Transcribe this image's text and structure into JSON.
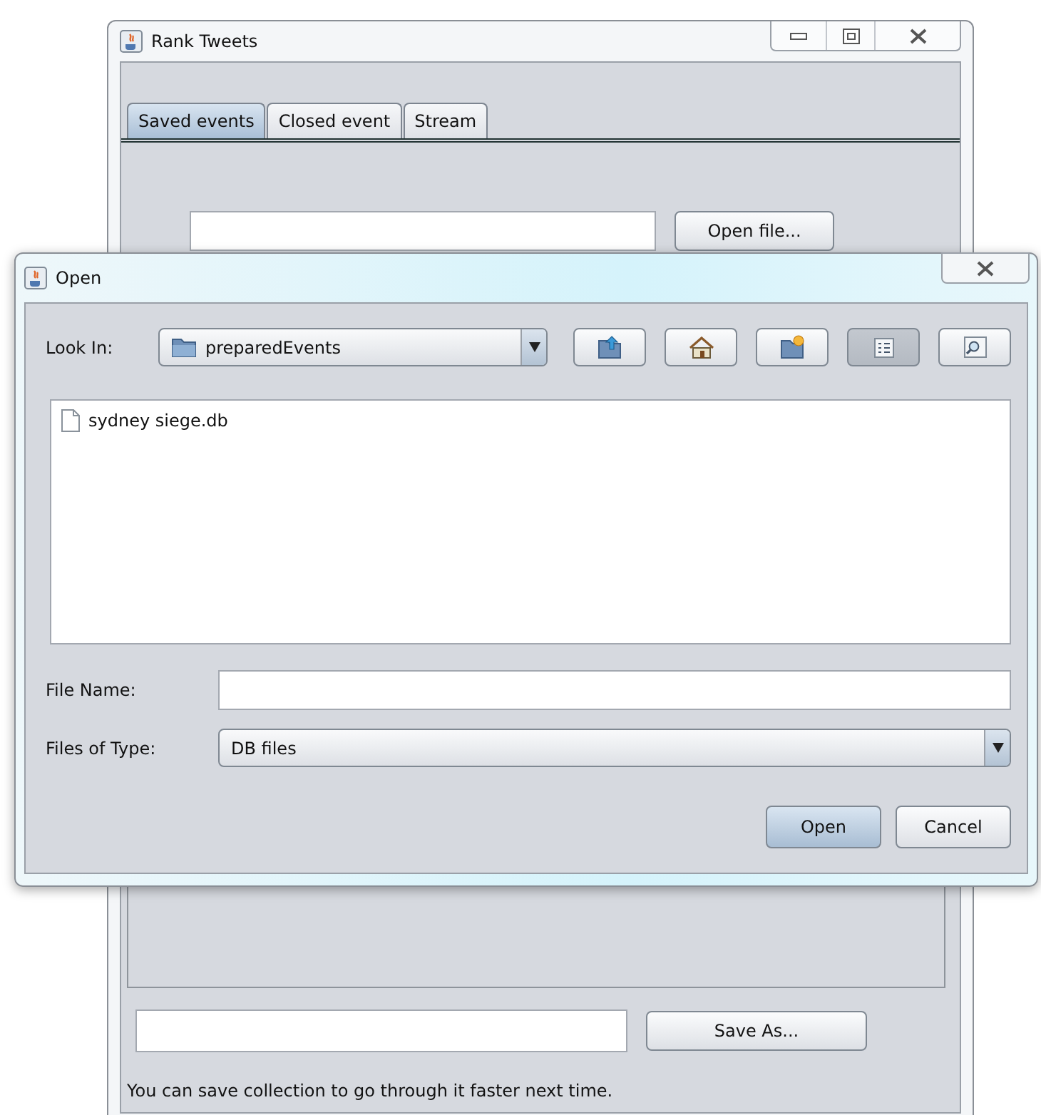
{
  "main_window": {
    "title": "Rank Tweets",
    "tabs": [
      {
        "label": "Saved events",
        "selected": true
      },
      {
        "label": "Closed event",
        "selected": false
      },
      {
        "label": "Stream",
        "selected": false
      }
    ],
    "open_file_button": "Open file...",
    "save_as_button": "Save As...",
    "hint": "You can save collection to go through it faster next time."
  },
  "dialog": {
    "title": "Open",
    "look_in": {
      "label": "Look In:",
      "value": "preparedEvents"
    },
    "toolbar": [
      {
        "kind": "up",
        "pressed": false
      },
      {
        "kind": "home",
        "pressed": false
      },
      {
        "kind": "new-folder",
        "pressed": false
      },
      {
        "kind": "list",
        "pressed": true
      },
      {
        "kind": "details",
        "pressed": false
      }
    ],
    "files": [
      {
        "name": "sydney siege.db"
      }
    ],
    "file_name": {
      "label": "File Name:"
    },
    "file_type": {
      "label": "Files of Type:",
      "value": "DB files"
    },
    "buttons": [
      {
        "label": "Open",
        "default": true
      },
      {
        "label": "Cancel",
        "default": false
      }
    ]
  }
}
